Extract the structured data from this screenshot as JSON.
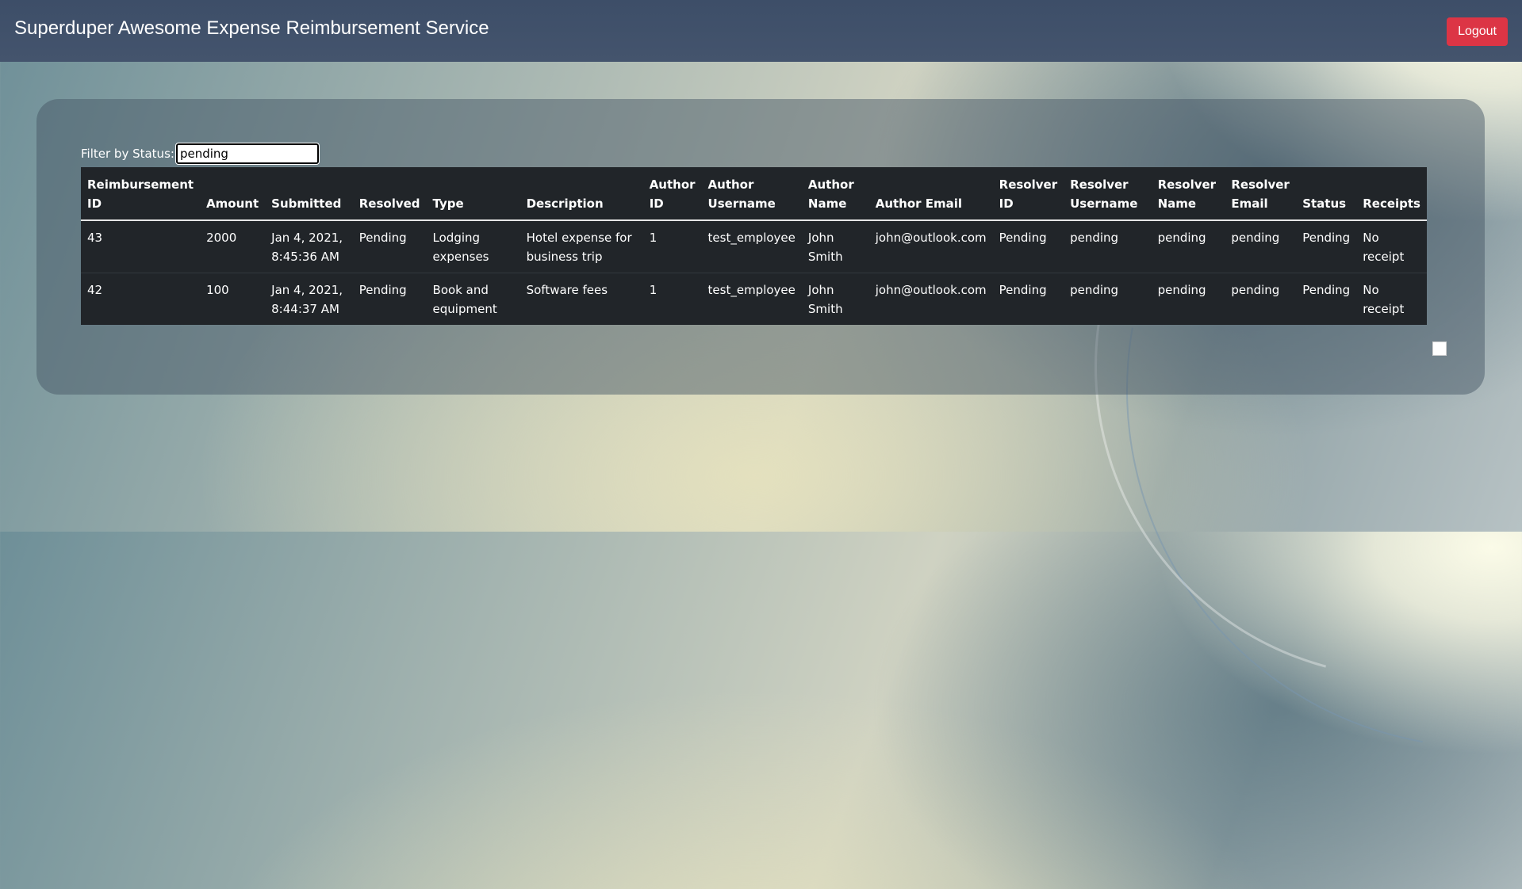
{
  "header": {
    "title": "Superduper Awesome Expense Reimbursement Service",
    "logout_label": "Logout",
    "logout_color": "#dc3545"
  },
  "filter": {
    "label": "Filter by Status:",
    "value": "pending"
  },
  "table": {
    "columns": [
      "Reimbursement ID",
      "Amount",
      "Submitted",
      "Resolved",
      "Type",
      "Description",
      "Author ID",
      "Author Username",
      "Author Name",
      "Author Email",
      "Resolver ID",
      "Resolver Username",
      "Resolver Name",
      "Resolver Email",
      "Status",
      "Receipts"
    ],
    "rows": [
      [
        "43",
        "2000",
        "Jan 4, 2021, 8:45:36 AM",
        "Pending",
        "Lodging expenses",
        "Hotel expense for business trip",
        "1",
        "test_employee",
        "John Smith",
        "john@outlook.com",
        "Pending",
        "pending",
        "pending",
        "pending",
        "Pending",
        "No receipt"
      ],
      [
        "42",
        "100",
        "Jan 4, 2021, 8:44:37 AM",
        "Pending",
        "Book and equipment",
        "Software fees",
        "1",
        "test_employee",
        "John Smith",
        "john@outlook.com",
        "Pending",
        "pending",
        "pending",
        "pending",
        "Pending",
        "No receipt"
      ]
    ]
  }
}
